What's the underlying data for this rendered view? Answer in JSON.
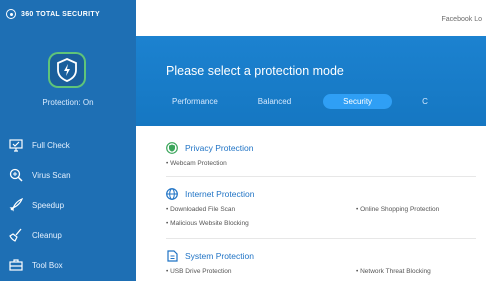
{
  "app": {
    "title": "360 TOTAL SECURITY"
  },
  "sidebar": {
    "protection_status": "Protection: On",
    "items": [
      {
        "label": "Full Check",
        "icon": "full-check-icon"
      },
      {
        "label": "Virus Scan",
        "icon": "virus-scan-icon"
      },
      {
        "label": "Speedup",
        "icon": "speedup-icon"
      },
      {
        "label": "Cleanup",
        "icon": "cleanup-icon"
      },
      {
        "label": "Tool Box",
        "icon": "toolbox-icon"
      }
    ]
  },
  "header": {
    "facebook_text": "Facebook Lo"
  },
  "banner": {
    "title": "Please select a protection mode",
    "tabs": [
      {
        "label": "Performance",
        "active": false
      },
      {
        "label": "Balanced",
        "active": false
      },
      {
        "label": "Security",
        "active": true
      },
      {
        "label": "C",
        "active": false
      }
    ]
  },
  "sections": [
    {
      "title": "Privacy Protection",
      "icon": "shield-check-icon",
      "items": [
        "Webcam Protection"
      ]
    },
    {
      "title": "Internet Protection",
      "icon": "globe-icon",
      "items": [
        "Downloaded File Scan",
        "Online Shopping Protection",
        "Malicious Website Blocking"
      ]
    },
    {
      "title": "System Protection",
      "icon": "system-file-icon",
      "items": [
        "USB Drive Protection",
        "Network Threat Blocking"
      ]
    }
  ],
  "colors": {
    "sidebar": "#1e6fb4",
    "banner": "#1a7dcc",
    "accent": "#2f9ff5",
    "link": "#1f73c5",
    "status_ok": "#5fc47a"
  }
}
